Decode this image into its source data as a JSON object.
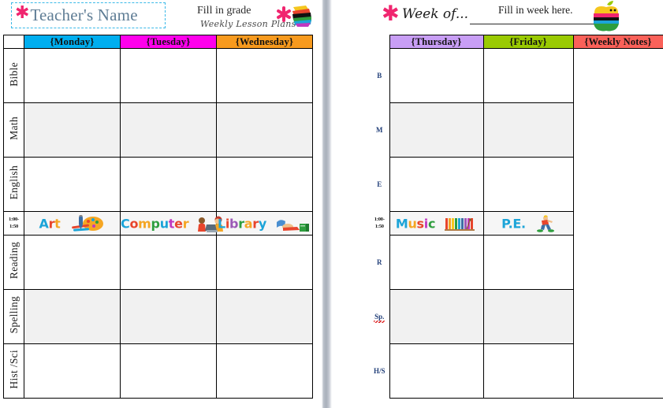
{
  "colors": {
    "monday": "#00AEEF",
    "tuesday": "#FF00EC",
    "wednesday": "#F79A1E",
    "thursday": "#C89EF5",
    "friday": "#9ACA02",
    "weekly_notes": "#FA6159",
    "accent_pink": "#F0256F",
    "name_border": "#3AB9E8",
    "name_text": "#5F7D95",
    "alt_row": "#F1F1F1",
    "gutter": "#A9B0BB"
  },
  "left_panel": {
    "teacher_name": {
      "asterisk": "asterisk-icon",
      "text": "Teacher's Name"
    },
    "grade_prompt": {
      "line1": "Fill in grade",
      "line2": "Weekly Lesson Plans",
      "logo": "weekly-lesson-plans-logo"
    },
    "columns": [
      "{Monday}",
      "{Tuesday}",
      "{Wednesday}"
    ],
    "rows": [
      {
        "label": "Bible",
        "type": "subject",
        "shaded": false
      },
      {
        "label": "Math",
        "type": "subject",
        "shaded": true
      },
      {
        "label": "English",
        "type": "subject",
        "shaded": false
      },
      {
        "label": "1:00-\n1:50",
        "type": "activity",
        "shaded": true
      },
      {
        "label": "Reading",
        "type": "subject",
        "shaded": false
      },
      {
        "label": "Spelling",
        "type": "subject",
        "shaded": true
      },
      {
        "label": "Hist /Sci",
        "type": "subject",
        "shaded": false
      }
    ],
    "activities": [
      {
        "name": "Art",
        "icon": "art-palette-icon",
        "letters": [
          [
            "A",
            "#1CA4D8"
          ],
          [
            "r",
            "#E8452C"
          ],
          [
            "t",
            "#F5A623"
          ]
        ]
      },
      {
        "name": "Computer",
        "icon": "computer-kids-icon",
        "letters": [
          [
            "C",
            "#1CA4D8"
          ],
          [
            "o",
            "#E8452C"
          ],
          [
            "m",
            "#F5A623"
          ],
          [
            "p",
            "#2E9E3E"
          ],
          [
            "u",
            "#1CA4D8"
          ],
          [
            "t",
            "#C038C0"
          ],
          [
            "e",
            "#E8452C"
          ],
          [
            "r",
            "#F5A623"
          ]
        ]
      },
      {
        "name": "Library",
        "icon": "library-books-icon",
        "letters": [
          [
            "L",
            "#1CA4D8"
          ],
          [
            "i",
            "#E8452C"
          ],
          [
            "b",
            "#9B59B6"
          ],
          [
            "r",
            "#2E9E3E"
          ],
          [
            "a",
            "#F5A623"
          ],
          [
            "r",
            "#E8452C"
          ],
          [
            "y",
            "#1CA4D8"
          ]
        ]
      }
    ]
  },
  "right_panel": {
    "week_of": {
      "asterisk": "asterisk-icon",
      "label": "Week of...",
      "dots": "...",
      "fill_prompt": "Fill in week here.",
      "logo": "rainbow-apple-logo"
    },
    "columns": [
      "{Thursday}",
      "{Friday}",
      "{Weekly Notes}"
    ],
    "rows": [
      {
        "label": "B",
        "type": "subject",
        "shaded": false
      },
      {
        "label": "M",
        "type": "subject",
        "shaded": true
      },
      {
        "label": "E",
        "type": "subject",
        "shaded": false
      },
      {
        "label": "1:00-\n1:50",
        "type": "activity",
        "shaded": true
      },
      {
        "label": "R",
        "type": "subject",
        "shaded": false
      },
      {
        "label": "Sp.",
        "type": "subject",
        "shaded": true,
        "spellcheck": true
      },
      {
        "label": "H/S",
        "type": "subject",
        "shaded": false
      }
    ],
    "activities": [
      {
        "name": "Music",
        "icon": "xylophone-icon",
        "letters": [
          [
            "M",
            "#1CA4D8"
          ],
          [
            "u",
            "#F5A623"
          ],
          [
            "s",
            "#E8452C"
          ],
          [
            "i",
            "#C038C0"
          ],
          [
            "c",
            "#2E9E3E"
          ]
        ]
      },
      {
        "name": "P.E.",
        "icon": "runner-icon",
        "letters": [
          [
            "P",
            ".",
            "#1CA4D8"
          ]
        ]
      }
    ],
    "pe_label": "P.E."
  }
}
